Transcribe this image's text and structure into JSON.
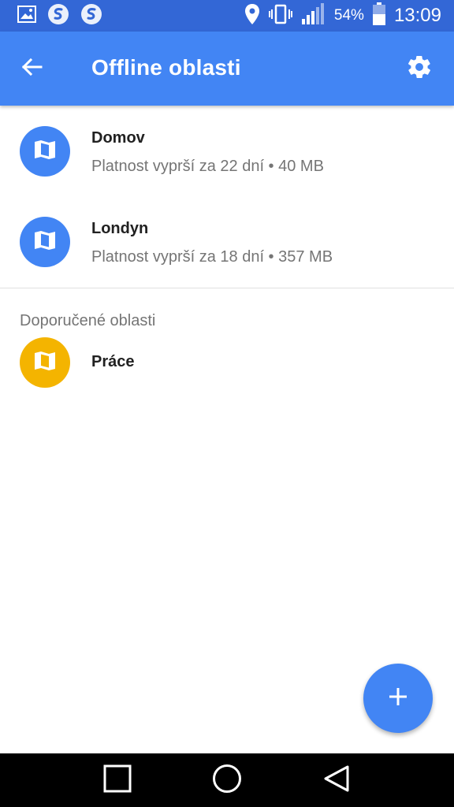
{
  "status_bar": {
    "battery": "54%",
    "time": "13:09",
    "icons": [
      "image-icon",
      "swiftkey-icon",
      "swiftkey-icon",
      "location-icon",
      "vibrate-icon",
      "signal-icon",
      "battery-icon"
    ]
  },
  "app_bar": {
    "title": "Offline oblasti",
    "back_icon": "arrow-back-icon",
    "settings_icon": "gear-icon"
  },
  "areas": [
    {
      "name": "Domov",
      "meta": "Platnost vyprší za 22 dní • 40 MB",
      "icon": "map-icon",
      "color": "#4285f4"
    },
    {
      "name": "Londyn",
      "meta": "Platnost vyprší za 18 dní • 357 MB",
      "icon": "map-icon",
      "color": "#4285f4"
    }
  ],
  "suggested": {
    "header": "Doporučené oblasti",
    "items": [
      {
        "name": "Práce",
        "icon": "map-icon",
        "color": "#f4b400"
      }
    ]
  },
  "fab": {
    "icon": "plus-icon",
    "color": "#4285f4"
  },
  "nav_bar": {
    "icons": [
      "recents-square-icon",
      "home-circle-icon",
      "back-triangle-icon"
    ]
  },
  "colors": {
    "status_bar": "#3367d6",
    "app_bar": "#4285f4",
    "accent_yellow": "#f4b400"
  }
}
